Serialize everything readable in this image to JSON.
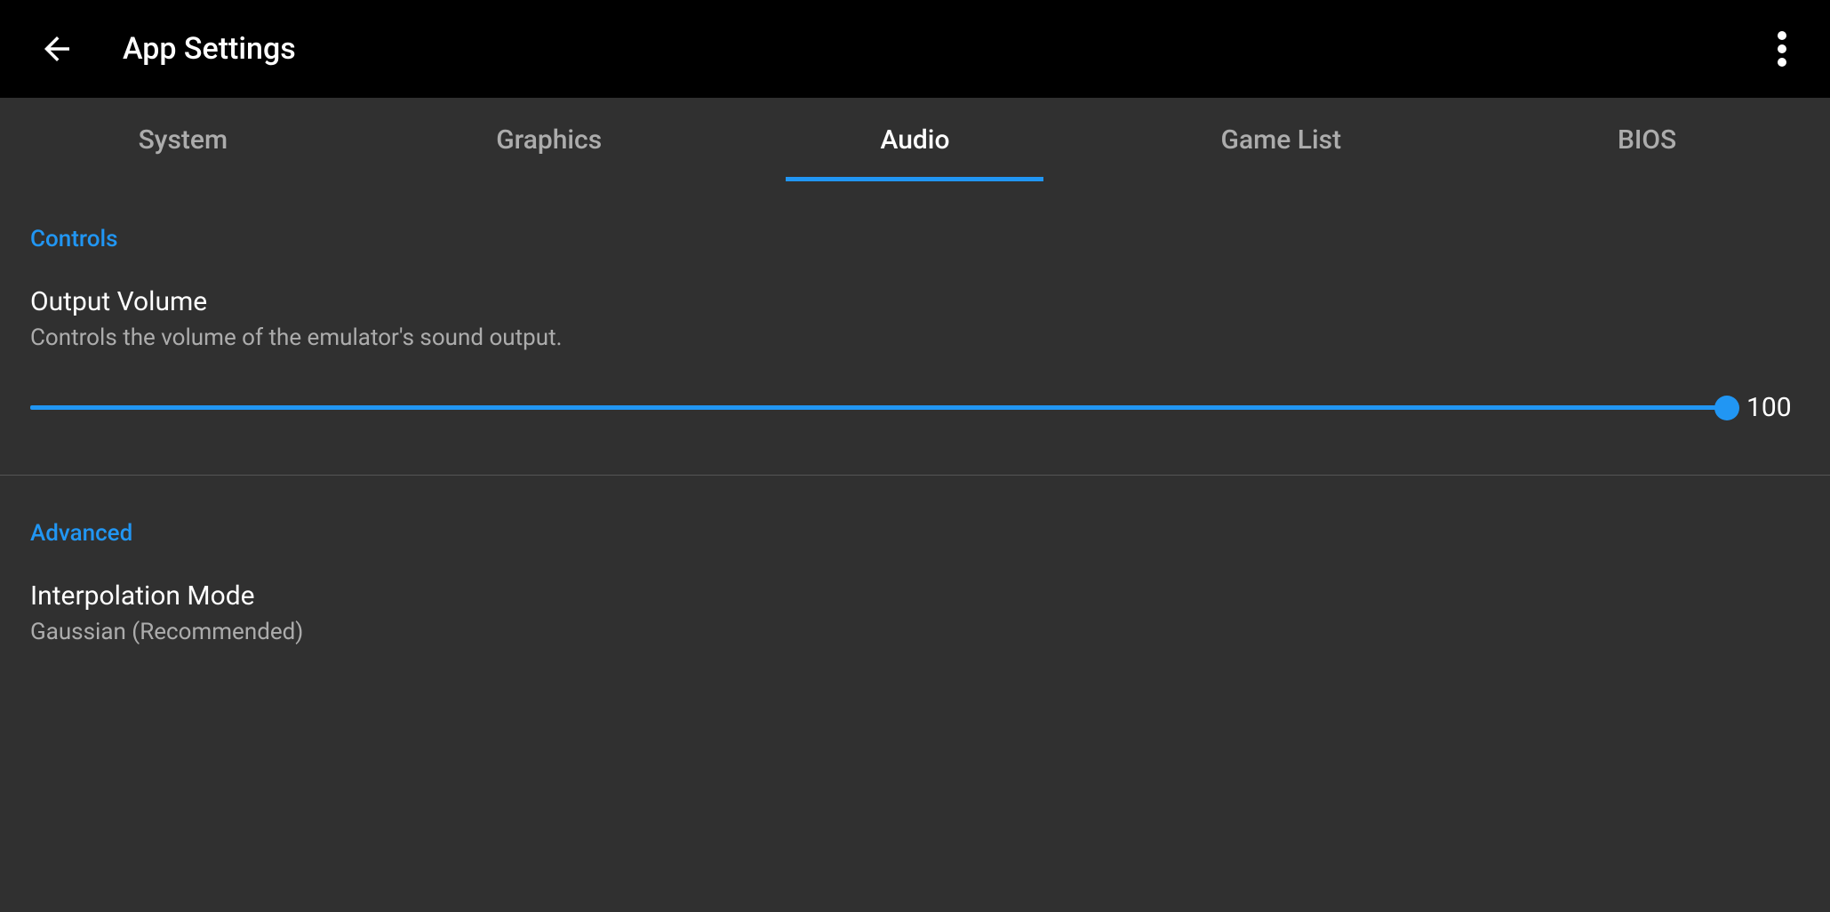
{
  "header": {
    "title": "App Settings"
  },
  "tabs": {
    "items": [
      {
        "label": "System"
      },
      {
        "label": "Graphics"
      },
      {
        "label": "Audio"
      },
      {
        "label": "Game List"
      },
      {
        "label": "BIOS"
      }
    ],
    "active_index": 2
  },
  "sections": {
    "controls": {
      "header": "Controls",
      "output_volume": {
        "title": "Output Volume",
        "subtitle": "Controls the volume of the emulator's sound output.",
        "value": "100"
      }
    },
    "advanced": {
      "header": "Advanced",
      "interpolation": {
        "title": "Interpolation Mode",
        "subtitle": "Gaussian (Recommended)"
      }
    }
  },
  "colors": {
    "accent": "#2196f3",
    "background": "#303030"
  }
}
